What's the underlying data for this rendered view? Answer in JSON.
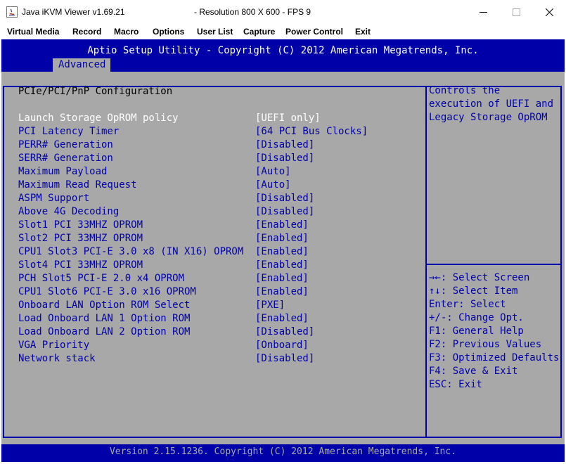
{
  "window": {
    "app_title": "Java iKVM Viewer v1.69.21",
    "resolution_title": "- Resolution 800 X 600 - FPS 9",
    "controls": {
      "minimize": "—",
      "maximize": "☐",
      "close": "✕"
    }
  },
  "menu": [
    "Virtual Media",
    "Record",
    "Macro",
    "Options",
    "User List",
    "Capture",
    "Power Control",
    "Exit"
  ],
  "bios": {
    "header": "Aptio Setup Utility - Copyright (C) 2012 American Megatrends, Inc.",
    "tab": "Advanced",
    "section_title": "PCIe/PCI/PnP Configuration",
    "settings": [
      {
        "label": "Launch Storage OpROM policy",
        "value": "[UEFI only]",
        "selected": true
      },
      {
        "label": "PCI Latency Timer",
        "value": "[64 PCI Bus Clocks]"
      },
      {
        "label": "PERR# Generation",
        "value": "[Disabled]"
      },
      {
        "label": "SERR# Generation",
        "value": "[Disabled]"
      },
      {
        "label": "Maximum Payload",
        "value": "[Auto]"
      },
      {
        "label": "Maximum Read Request",
        "value": "[Auto]"
      },
      {
        "label": "ASPM Support",
        "value": "[Disabled]"
      },
      {
        "label": "Above 4G Decoding",
        "value": "[Disabled]"
      },
      {
        "label": "Slot1 PCI 33MHZ OPROM",
        "value": "[Enabled]"
      },
      {
        "label": "Slot2 PCI 33MHZ OPROM",
        "value": "[Enabled]"
      },
      {
        "label": "CPU1 Slot3 PCI-E 3.0 x8 (IN X16) OPROM",
        "value": "[Enabled]"
      },
      {
        "label": "Slot4 PCI 33MHZ OPROM",
        "value": "[Enabled]"
      },
      {
        "label": "PCH Slot5 PCI-E 2.0 x4 OPROM",
        "value": "[Enabled]"
      },
      {
        "label": "CPU1 Slot6 PCI-E 3.0 x16 OPROM",
        "value": "[Enabled]"
      },
      {
        "label": "Onboard LAN Option ROM Select",
        "value": "[PXE]"
      },
      {
        "label": "Load Onboard LAN 1 Option ROM",
        "value": "[Enabled]"
      },
      {
        "label": "Load Onboard LAN 2 Option ROM",
        "value": "[Disabled]"
      },
      {
        "label": "VGA Priority",
        "value": "[Onboard]"
      },
      {
        "label": "Network stack",
        "value": "[Disabled]"
      }
    ],
    "help_text": [
      "Controls the",
      "execution of UEFI and",
      "Legacy Storage OpROM"
    ],
    "key_help": [
      "→←: Select Screen",
      "↑↓: Select Item",
      "Enter: Select",
      "+/-: Change Opt.",
      "F1: General Help",
      "F2: Previous Values",
      "F3: Optimized Defaults",
      "F4: Save & Exit",
      "ESC: Exit"
    ],
    "footer": "Version 2.15.1236. Copyright (C) 2012 American Megatrends, Inc.",
    "colors": {
      "background": "#0000a8",
      "panel": "#a8a8a8",
      "text": "#0000a8",
      "selected": "#ffffff"
    }
  }
}
